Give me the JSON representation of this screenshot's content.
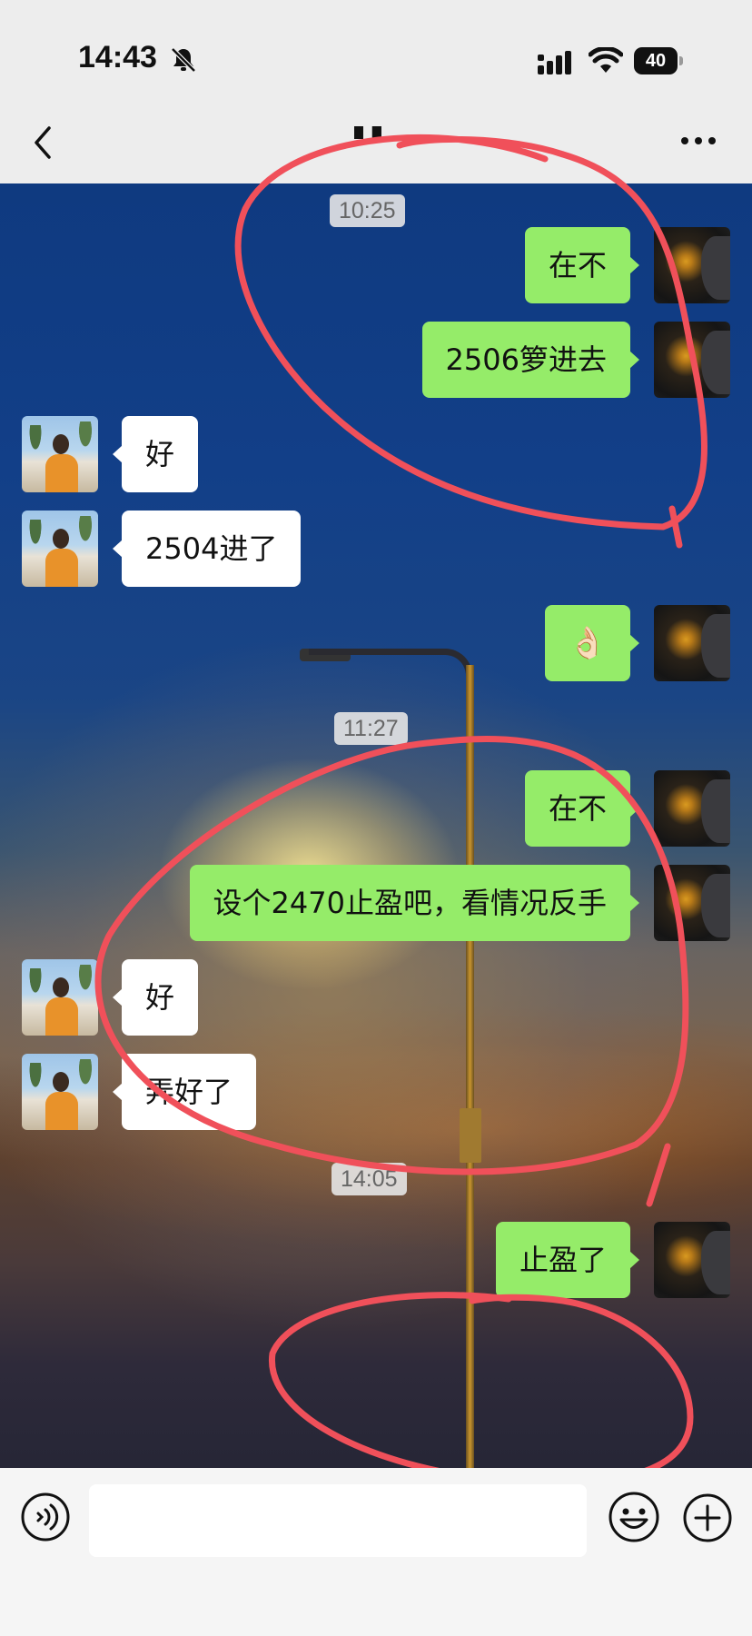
{
  "status_bar": {
    "time": "14:43",
    "battery": "40",
    "icons": [
      "bell-mute-icon",
      "signal-icon",
      "wifi-icon",
      "battery-icon"
    ]
  },
  "nav": {
    "title": "▌▌",
    "back_icon": "chevron-left-icon",
    "more_icon": "more-dots-icon"
  },
  "messages": [
    {
      "type": "time",
      "text": "10:25"
    },
    {
      "type": "out",
      "text": "在不"
    },
    {
      "type": "out",
      "text": "2506箩进去"
    },
    {
      "type": "in",
      "text": "好"
    },
    {
      "type": "in",
      "text": "2504进了"
    },
    {
      "type": "out",
      "text": "👌🏻"
    },
    {
      "type": "time",
      "text": "11:27"
    },
    {
      "type": "out",
      "text": "在不"
    },
    {
      "type": "out",
      "text": "设个2470止盈吧，看情况反手"
    },
    {
      "type": "in",
      "text": "好"
    },
    {
      "type": "in",
      "text": "弄好了"
    },
    {
      "type": "time",
      "text": "14:05"
    },
    {
      "type": "out",
      "text": "止盈了"
    }
  ],
  "input_bar": {
    "placeholder": "",
    "voice_icon": "voice-icon",
    "emoji_icon": "emoji-icon",
    "plus_icon": "plus-icon"
  },
  "colors": {
    "outgoing_bubble": "#95ec69",
    "incoming_bubble": "#ffffff",
    "annotation": "#f0505a",
    "bar_background": "#ededed"
  }
}
